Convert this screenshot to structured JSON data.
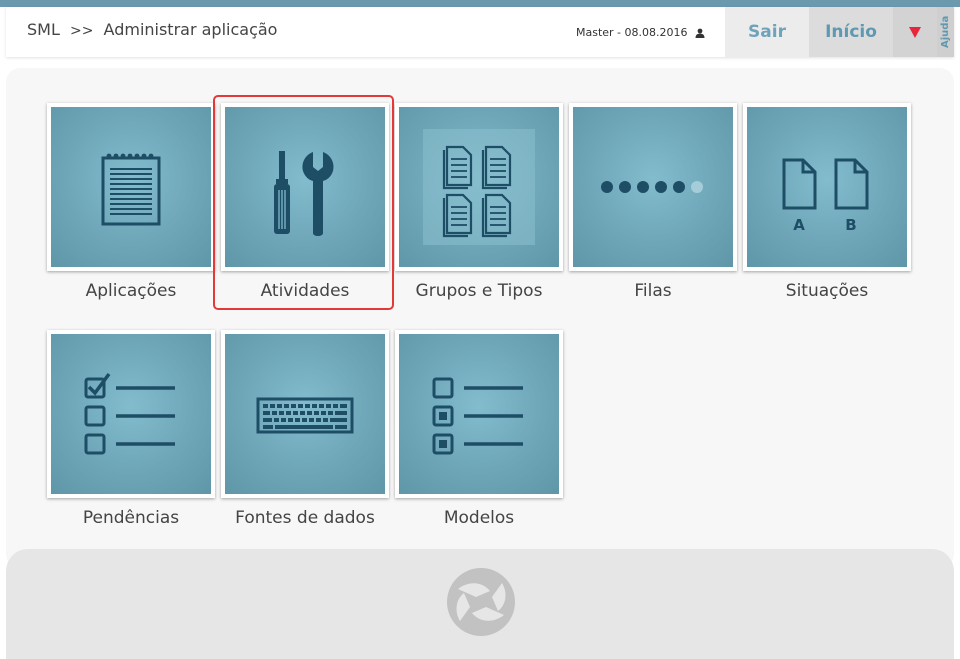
{
  "header": {
    "breadcrumb_root": "SML",
    "breadcrumb_sep": ">>",
    "breadcrumb_current": "Administrar aplicação",
    "user_info": "Master - 08.08.2016",
    "sair_label": "Sair",
    "inicio_label": "Início",
    "help_label": "Ajuda"
  },
  "tiles": [
    {
      "label": "Aplicações",
      "icon": "notepad-icon"
    },
    {
      "label": "Atividades",
      "icon": "tools-icon",
      "selected": true
    },
    {
      "label": "Grupos e Tipos",
      "icon": "documents-grid-icon"
    },
    {
      "label": "Filas",
      "icon": "dots-queue-icon"
    },
    {
      "label": "Situações",
      "icon": "documents-ab-icon"
    },
    {
      "label": "Pendências",
      "icon": "checklist-icon"
    },
    {
      "label": "Fontes de dados",
      "icon": "keyboard-icon"
    },
    {
      "label": "Modelos",
      "icon": "list-template-icon"
    }
  ],
  "colors": {
    "accent": "#5e98b1",
    "tile_bg": "#6ea6b8",
    "icon": "#1e4d66",
    "highlight": "#e53838",
    "menu_arrow": "#e8263a"
  }
}
